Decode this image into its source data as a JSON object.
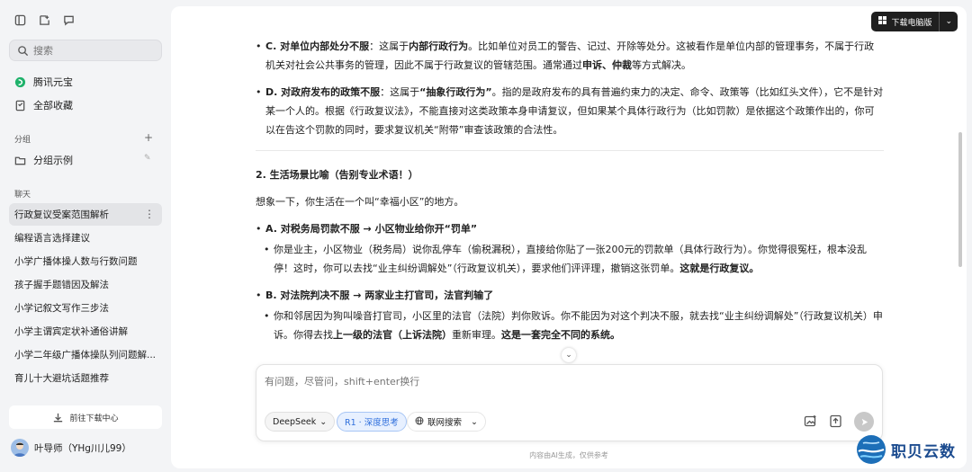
{
  "sidebar": {
    "search_placeholder": "搜索",
    "app_name": "腾讯元宝",
    "favorites_label": "全部收藏",
    "groups_label": "分组",
    "group_example": "分组示例",
    "chats_label": "聊天",
    "chats": [
      "行政复议受案范围解析",
      "编程语言选择建议",
      "小学广播体操人数与行数问题",
      "孩子握手题错因及解法",
      "小学记叙文写作三步法",
      "小学主谓宾定状补通俗讲解",
      "小学二年级广播体操队列问题解...",
      "育儿十大避坑话题推荐"
    ],
    "download_center": "前往下载中心",
    "user_name": "叶导师（YHg川儿99）"
  },
  "header": {
    "download_desktop": "下载电脑版"
  },
  "content": {
    "c_title": "C. 对单位内部处分不服",
    "c_text1": "：这属于",
    "c_bold1": "内部行政行为",
    "c_text2": "。比如单位对员工的警告、记过、开除等处分。这被看作是单位内部的管理事务，不属于行政机关对社会公共事务的管理，因此不属于行政复议的管辖范围。通常通过",
    "c_bold2": "申诉、仲裁",
    "c_text3": "等方式解决。",
    "d_title": "D. 对政府发布的政策不服",
    "d_text1": "：这属于",
    "d_bold1": "“抽象行政行为”",
    "d_text2": "。指的是政府发布的具有普遍约束力的决定、命令、政策等（比如红头文件），它不是针对某一个人的。根据《行政复议法》，不能直接对这类政策本身申请复议，但如果某个具体行政行为（比如罚款）是依据这个政策作出的，你可以在告这个罚款的同时，要求复议机关“附带”审查该政策的合法性。",
    "s2_title": "2. 生活场景比喻（告别专业术语！）",
    "s2_intro": "想象一下，你生活在一个叫“幸福小区”的地方。",
    "a_title": "A. 对税务局罚款不服 → 小区物业给你开“罚单”",
    "a_sub_text": "你是业主，小区物业（税务局）说你乱停车（偷税漏税），直接给你贴了一张200元的罚款单（具体行政行为）。你觉得很冤枉，根本没乱停！这时，你可以去找“业主纠纷调解处”（行政复议机关），要求他们评评理，撤销这张罚单。",
    "a_sub_bold": "这就是行政复议。",
    "b_title": "B. 对法院判决不服 → 两家业主打官司，法官判输了",
    "b_sub_text1": "你和邻居因为狗叫噪音打官司，小区里的法官（法院）判你败诉。你不能因为对这个判决不服，就去找“业主纠纷调解处”（行政复议机关）申诉。你得去找",
    "b_sub_bold1": "上一级的法官（上诉法院）",
    "b_sub_text2": "重新审理。",
    "b_sub_bold2": "这是一套完全不同的系统。"
  },
  "composer": {
    "placeholder": "有问题，尽管问，shift+enter换行",
    "model": "DeepSeek",
    "deep_think": "R1 · 深度思考",
    "web_search": "联网搜索"
  },
  "footer_note": "内容由AI生成，仅供参考",
  "watermark": "职贝云数"
}
